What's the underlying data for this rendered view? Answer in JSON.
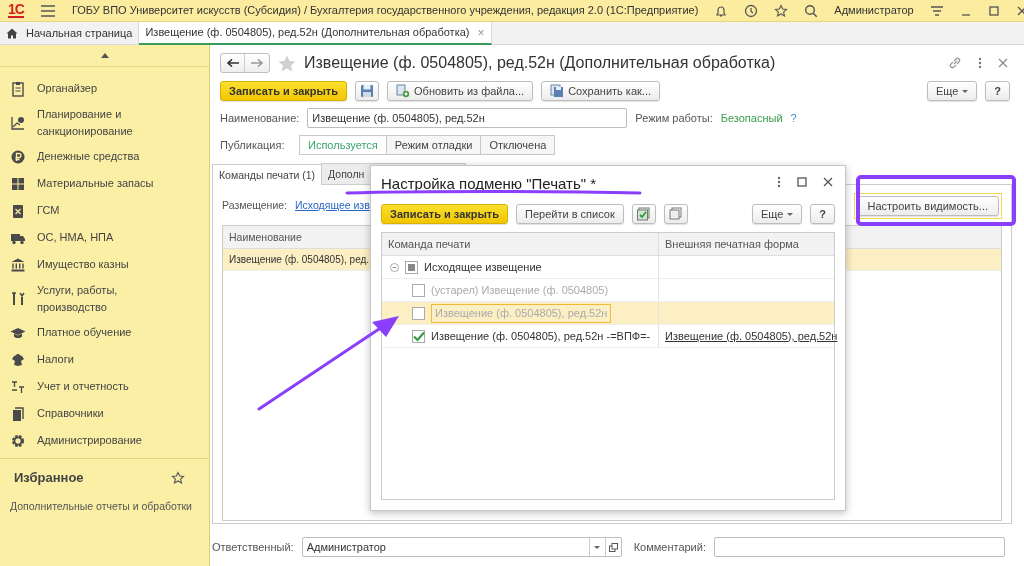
{
  "window": {
    "logo": "1С",
    "title": "ГОБУ ВПО Университет искусств (Субсидия) / Бухгалтерия государственного учреждения, редакция 2.0  (1С:Предприятие)",
    "user": "Администратор"
  },
  "open_tabs": [
    {
      "label": "Начальная страница",
      "kind": "home",
      "selected": false
    },
    {
      "label": "Извещение (ф. 0504805), ред.52н (Дополнительная обработка)",
      "kind": "document",
      "selected": true,
      "close": "×"
    }
  ],
  "sidebar": {
    "items": [
      {
        "label": "Органайзер"
      },
      {
        "label": "Планирование и санкционирование"
      },
      {
        "label": "Денежные средства"
      },
      {
        "label": "Материальные запасы"
      },
      {
        "label": "ГСМ"
      },
      {
        "label": "ОС, НМА, НПА"
      },
      {
        "label": "Имущество казны"
      },
      {
        "label": "Услуги, работы, производство"
      },
      {
        "label": "Платное обучение"
      },
      {
        "label": "Налоги"
      },
      {
        "label": "Учет и отчетность"
      },
      {
        "label": "Справочники"
      },
      {
        "label": "Администрирование"
      }
    ],
    "favorites": {
      "title": "Избранное",
      "items": [
        "Дополнительные отчеты и обработки"
      ]
    }
  },
  "form": {
    "title": "Извещение (ф. 0504805), ред.52н (Дополнительная обработка)",
    "toolbar": [
      {
        "kind": "primary",
        "label": "Записать и закрыть"
      },
      {
        "kind": "icon"
      },
      {
        "kind": "icon-text",
        "label": "Обновить из файла..."
      },
      {
        "kind": "icon-text",
        "label": "Сохранить как..."
      }
    ],
    "more": "Еще",
    "help": "?",
    "name_label": "Наименование:",
    "name_value": "Извещение (ф. 0504805), ред.52н",
    "mode_label": "Режим работы:",
    "mode_value": "Безопасный",
    "mode_help": "?",
    "publication_label": "Публикация:",
    "publication_options": [
      {
        "label": "Используется",
        "selected": true
      },
      {
        "label": "Режим отладки",
        "selected": false
      },
      {
        "label": "Отключена",
        "selected": false
      }
    ],
    "tabs": [
      {
        "label": "Команды печати (1)",
        "selected": true
      },
      {
        "label": "Дополн",
        "selected": false
      }
    ],
    "placement_label": "Размещение:",
    "placement_link": "Исходящее изв",
    "visibility_button": "Настроить видимость...",
    "table": {
      "columns": [
        "Наименование"
      ],
      "rows": [
        {
          "cells": [
            "Извещение (ф. 0504805), ред."
          ],
          "selected": true
        }
      ]
    },
    "responsible_label": "Ответственный:",
    "responsible_value": "Администратор",
    "comment_label": "Комментарий:"
  },
  "dialog": {
    "title": "Настройка подменю \"Печать\" *",
    "toolbar": [
      {
        "kind": "primary",
        "label": "Записать и закрыть"
      },
      {
        "kind": "text",
        "label": "Перейти в список"
      },
      {
        "kind": "icon"
      },
      {
        "kind": "icon"
      }
    ],
    "more": "Еще",
    "help": "?",
    "columns": [
      "Команда печати",
      "Внешняя печатная форма"
    ],
    "rows": [
      {
        "kind": "group",
        "label": "Исходящее извещение",
        "expanded": true,
        "checked": false,
        "indeterminate": true,
        "selected": false,
        "children": [
          {
            "kind": "item",
            "label": "(устарел) Извещение (ф. 0504805)",
            "checked": false,
            "selected": false
          },
          {
            "kind": "item",
            "label": "Извещение (ф. 0504805), ред.52н",
            "checked": false,
            "selected": true
          },
          {
            "kind": "item",
            "label": "Извещение (ф. 0504805), ред.52н -=ВПФ=-",
            "checked": true,
            "selected": false,
            "print_form": "Извещение (ф. 0504805), ред.52н"
          }
        ]
      }
    ]
  }
}
